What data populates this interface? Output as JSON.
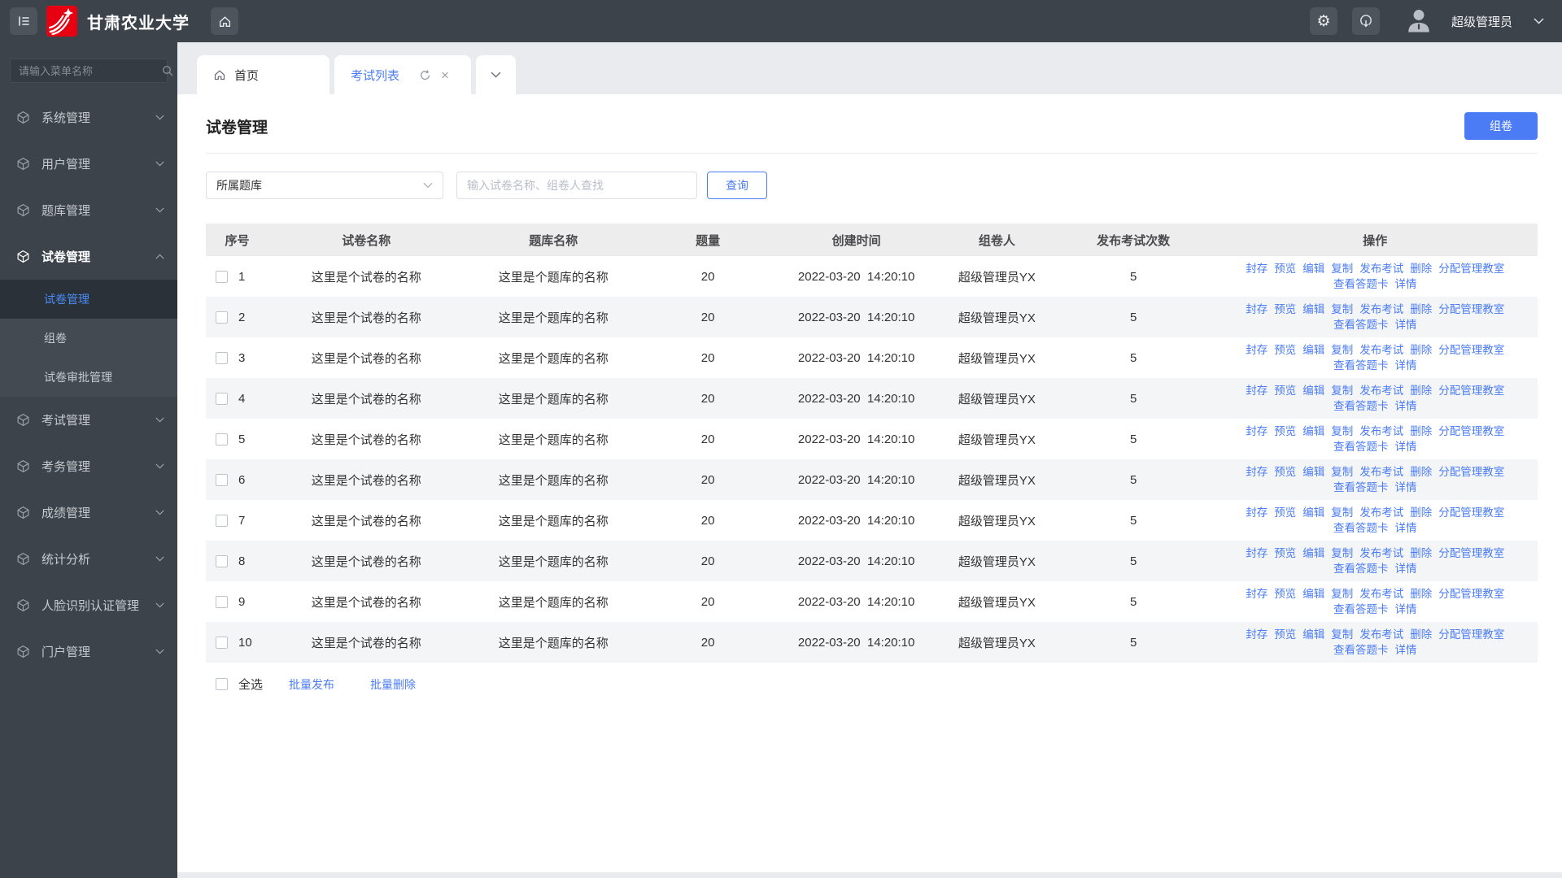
{
  "colors": {
    "topbar_bg": "#3d434b",
    "accent_blue": "#4b7cf5",
    "logo_red": "#e60012"
  },
  "topbar": {
    "title": "甘肃农业大学",
    "user": "超级管理员"
  },
  "sidebar": {
    "search_placeholder": "请输入菜单名称",
    "items": [
      {
        "label": "系统管理"
      },
      {
        "label": "用户管理"
      },
      {
        "label": "题库管理"
      },
      {
        "label": "试卷管理",
        "expanded": true,
        "children": [
          {
            "label": "试卷管理",
            "active": true
          },
          {
            "label": "组卷"
          },
          {
            "label": "试卷审批管理"
          }
        ]
      },
      {
        "label": "考试管理"
      },
      {
        "label": "考务管理"
      },
      {
        "label": "成绩管理"
      },
      {
        "label": "统计分析"
      },
      {
        "label": "人脸识别认证管理"
      },
      {
        "label": "门户管理"
      }
    ]
  },
  "tabs": [
    {
      "label": "首页"
    },
    {
      "label": "考试列表",
      "active": true
    }
  ],
  "page": {
    "title": "试卷管理",
    "compose_button": "组卷",
    "filters": {
      "library_select": "所属题库",
      "search_placeholder": "输入试卷名称、组卷人查找",
      "query_button": "查询"
    }
  },
  "table": {
    "headers": [
      "序号",
      "试卷名称",
      "题库名称",
      "题量",
      "创建时间",
      "组卷人",
      "发布考试次数",
      "操作"
    ],
    "actions_line1": [
      {
        "name": "archive",
        "label": "封存"
      },
      {
        "name": "preview",
        "label": "预览"
      },
      {
        "name": "edit",
        "label": "编辑"
      },
      {
        "name": "copy",
        "label": "复制"
      },
      {
        "name": "publish-exam",
        "label": "发布考试"
      },
      {
        "name": "delete",
        "label": "删除"
      },
      {
        "name": "assign-classroom",
        "label": "分配管理教室"
      }
    ],
    "actions_line2": [
      {
        "name": "view-answer-sheet",
        "label": "查看答题卡"
      },
      {
        "name": "details",
        "label": "详情"
      }
    ],
    "rows": [
      {
        "num": "1",
        "paper": "这里是个试卷的名称",
        "library": "这里是个题库的名称",
        "count": "20",
        "created": "2022-03-20  14:20:10",
        "creator": "超级管理员YX",
        "publish_count": "5"
      },
      {
        "num": "2",
        "paper": "这里是个试卷的名称",
        "library": "这里是个题库的名称",
        "count": "20",
        "created": "2022-03-20  14:20:10",
        "creator": "超级管理员YX",
        "publish_count": "5"
      },
      {
        "num": "3",
        "paper": "这里是个试卷的名称",
        "library": "这里是个题库的名称",
        "count": "20",
        "created": "2022-03-20  14:20:10",
        "creator": "超级管理员YX",
        "publish_count": "5"
      },
      {
        "num": "4",
        "paper": "这里是个试卷的名称",
        "library": "这里是个题库的名称",
        "count": "20",
        "created": "2022-03-20  14:20:10",
        "creator": "超级管理员YX",
        "publish_count": "5"
      },
      {
        "num": "5",
        "paper": "这里是个试卷的名称",
        "library": "这里是个题库的名称",
        "count": "20",
        "created": "2022-03-20  14:20:10",
        "creator": "超级管理员YX",
        "publish_count": "5"
      },
      {
        "num": "6",
        "paper": "这里是个试卷的名称",
        "library": "这里是个题库的名称",
        "count": "20",
        "created": "2022-03-20  14:20:10",
        "creator": "超级管理员YX",
        "publish_count": "5"
      },
      {
        "num": "7",
        "paper": "这里是个试卷的名称",
        "library": "这里是个题库的名称",
        "count": "20",
        "created": "2022-03-20  14:20:10",
        "creator": "超级管理员YX",
        "publish_count": "5"
      },
      {
        "num": "8",
        "paper": "这里是个试卷的名称",
        "library": "这里是个题库的名称",
        "count": "20",
        "created": "2022-03-20  14:20:10",
        "creator": "超级管理员YX",
        "publish_count": "5"
      },
      {
        "num": "9",
        "paper": "这里是个试卷的名称",
        "library": "这里是个题库的名称",
        "count": "20",
        "created": "2022-03-20  14:20:10",
        "creator": "超级管理员YX",
        "publish_count": "5"
      },
      {
        "num": "10",
        "paper": "这里是个试卷的名称",
        "library": "这里是个题库的名称",
        "count": "20",
        "created": "2022-03-20  14:20:10",
        "creator": "超级管理员YX",
        "publish_count": "5"
      }
    ]
  },
  "footer": {
    "select_all": "全选",
    "batch_publish": "批量发布",
    "batch_delete": "批量删除"
  }
}
